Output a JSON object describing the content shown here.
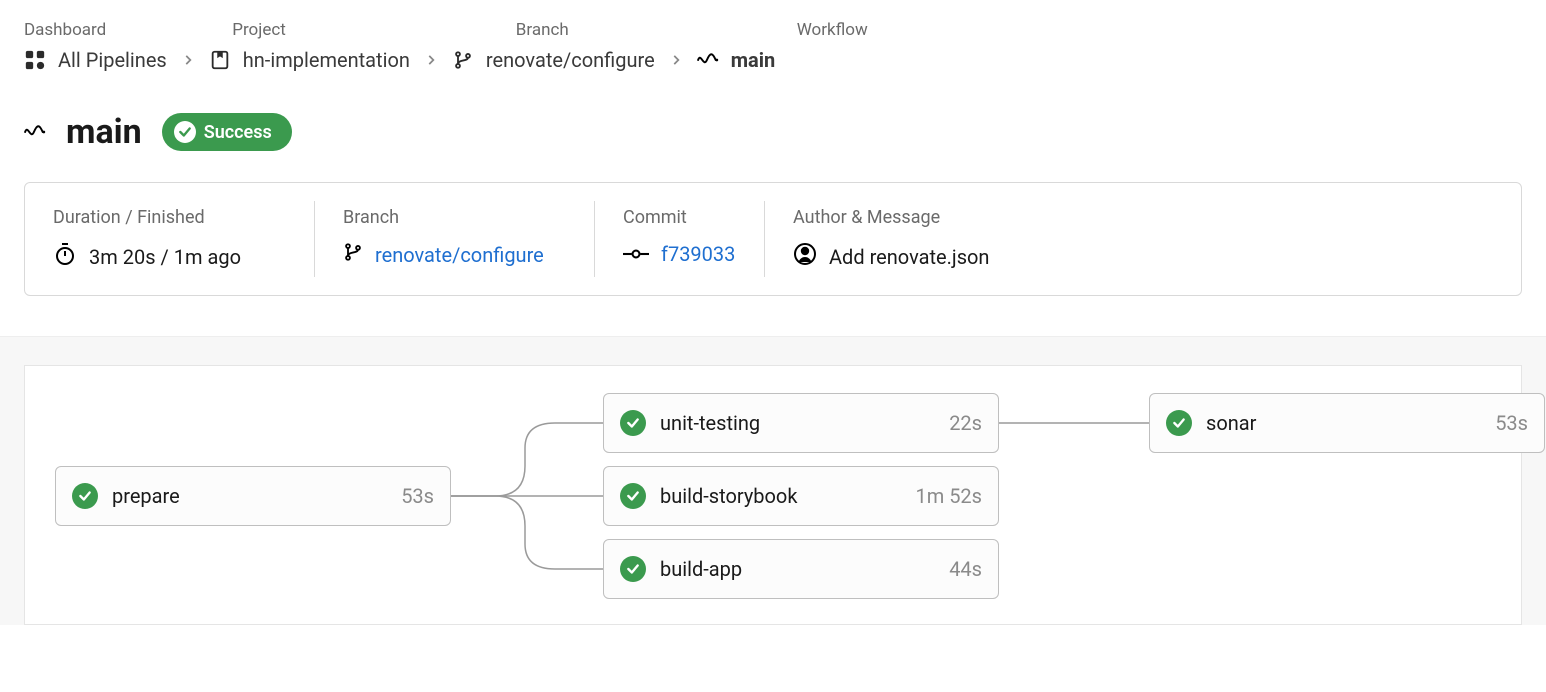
{
  "breadcrumb": {
    "labels": {
      "dashboard": "Dashboard",
      "project": "Project",
      "branch": "Branch",
      "workflow": "Workflow"
    },
    "dashboard": "All Pipelines",
    "project": "hn-implementation",
    "branch": "renovate/configure",
    "workflow": "main"
  },
  "title": {
    "name": "main",
    "status": "Success"
  },
  "info": {
    "duration_label": "Duration / Finished",
    "duration_value": "3m 20s / 1m ago",
    "branch_label": "Branch",
    "branch_value": "renovate/configure",
    "commit_label": "Commit",
    "commit_value": "f739033",
    "author_label": "Author & Message",
    "author_value": "Add renovate.json"
  },
  "jobs": {
    "prepare": {
      "name": "prepare",
      "duration": "53s"
    },
    "unit_testing": {
      "name": "unit-testing",
      "duration": "22s"
    },
    "build_storybook": {
      "name": "build-storybook",
      "duration": "1m 52s"
    },
    "build_app": {
      "name": "build-app",
      "duration": "44s"
    },
    "sonar": {
      "name": "sonar",
      "duration": "53s"
    }
  }
}
